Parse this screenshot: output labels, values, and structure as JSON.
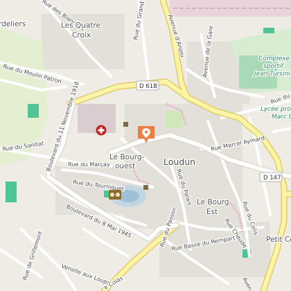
{
  "map": {
    "places": {
      "loudun": "Loudun",
      "le_bourg_ouest": "Le Bourg-",
      "le_bourg_ouest_2": "ouest",
      "le_bourg_est": "Le Bourg",
      "le_bourg_est_2": "Est",
      "les_quatre_croix": "Les Quatre",
      "les_quatre_croix_2": "Croix",
      "cordeliers": "rdeliers",
      "petit_cognac": "Petit Co"
    },
    "road_shields": {
      "d61b": "D 61B",
      "d147": "D 147"
    },
    "pois": {
      "complexe_1": "Complexe",
      "complexe_2": "sportif",
      "complexe_3": "Jean Tursini",
      "lycee_1": "Lycée prof",
      "lycee_2": "Marc G"
    },
    "streets": {
      "blanches": "Rue des Blanches",
      "grand": "Rue du Grand",
      "avenue_anjou": "Avenue d'Anjou",
      "gare": "Avenue de la Gare",
      "moulin_patron": "Rue du Moulin Patron",
      "onze_novembre": "Boulevard du 11 Novembre 1918",
      "sanitat": "Rue du Sanitat",
      "marcay": "Rue du Marçay",
      "tourniquet": "Rue du Tourniquet",
      "huit_mai": "Boulevard du 8 Mai 1945",
      "marcel_aymard": "Rue Marcel Aymard",
      "palais": "Rue du Palais",
      "stade": "Rue du Stade",
      "passoir": "Rue du Passoir",
      "basse_rempart": "Rue Basse du Rempart",
      "chaude": "Rue Chaude",
      "colis": "Rue du Colis",
      "grillemont": "Rue de Grillemont",
      "venelle": "Venelle aux Loups",
      "colas": "e Colas",
      "avenue_bottom": "Aven"
    },
    "colors": {
      "background": "#efece6",
      "major_road": "#fbf3a6",
      "major_road_casing": "#e2cf63",
      "minor_road": "#ffffff",
      "park": "#d8ecc8",
      "sports": "#c6e8cf",
      "built": "#e6e3dc",
      "pin": "#f07c40",
      "hospital": "#c81e1e"
    }
  }
}
